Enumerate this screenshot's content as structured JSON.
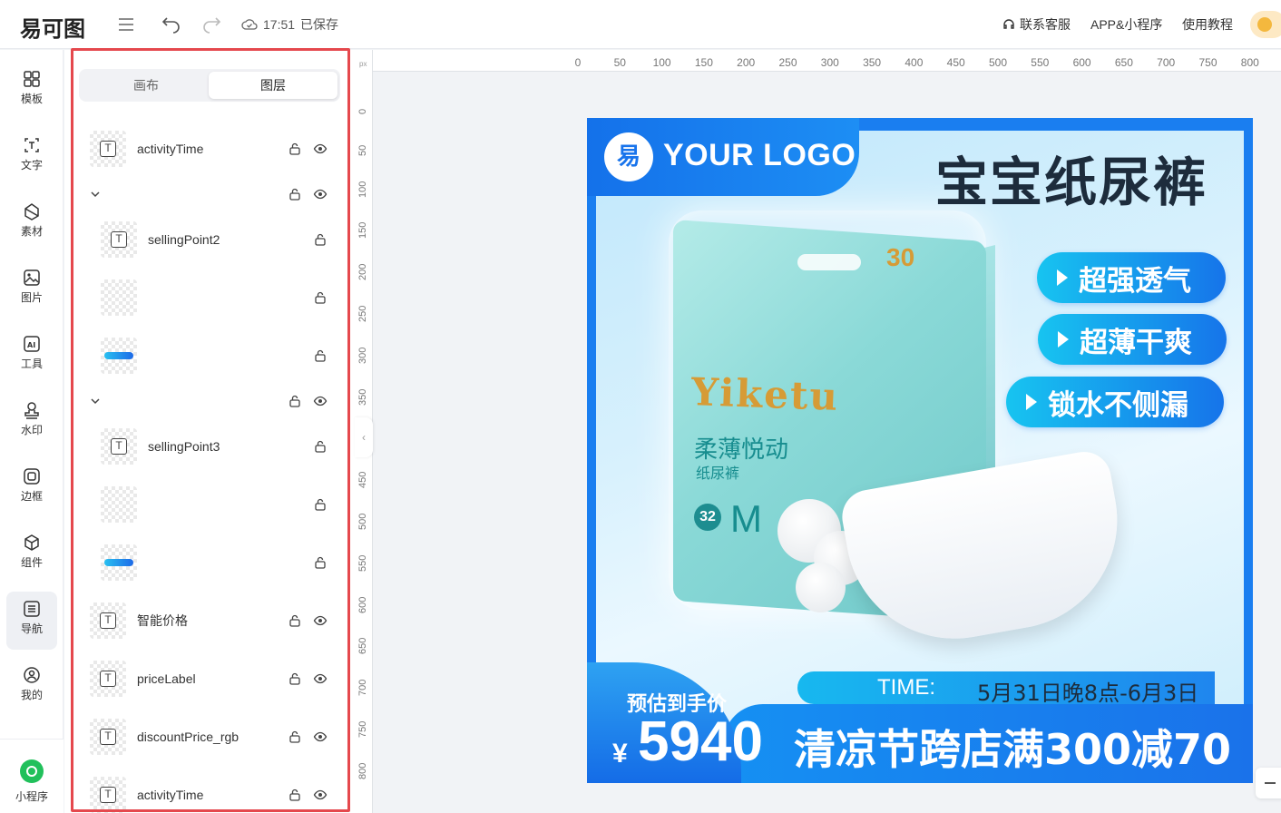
{
  "topbar": {
    "logo": "易可图",
    "save_time": "17:51",
    "save_status": "已保存",
    "contact": "联系客服",
    "app": "APP&小程序",
    "tutorial": "使用教程"
  },
  "rail": {
    "items": [
      {
        "label": "模板",
        "icon": "template-icon"
      },
      {
        "label": "文字",
        "icon": "text-icon"
      },
      {
        "label": "素材",
        "icon": "material-icon"
      },
      {
        "label": "图片",
        "icon": "image-icon"
      },
      {
        "label": "工具",
        "icon": "ai-tool-icon"
      },
      {
        "label": "水印",
        "icon": "watermark-icon"
      },
      {
        "label": "边框",
        "icon": "border-icon"
      },
      {
        "label": "组件",
        "icon": "component-icon"
      },
      {
        "label": "导航",
        "icon": "nav-icon"
      },
      {
        "label": "我的",
        "icon": "user-icon"
      }
    ],
    "mini_program": "小程序"
  },
  "panel": {
    "tab_canvas": "画布",
    "tab_layers": "图层",
    "layers": [
      {
        "name": "activityTime",
        "type": "text"
      },
      {
        "name": "",
        "type": "group"
      },
      {
        "name": "sellingPoint2",
        "type": "text"
      },
      {
        "name": "",
        "type": "image"
      },
      {
        "name": "",
        "type": "bar"
      },
      {
        "name": "",
        "type": "group"
      },
      {
        "name": "sellingPoint3",
        "type": "text"
      },
      {
        "name": "",
        "type": "image"
      },
      {
        "name": "",
        "type": "bar"
      },
      {
        "name": "智能价格",
        "type": "text"
      },
      {
        "name": "priceLabel",
        "type": "text"
      },
      {
        "name": "discountPrice_rgb",
        "type": "text"
      },
      {
        "name": "activityTime",
        "type": "text"
      }
    ]
  },
  "ruler": {
    "unit": "px",
    "top_ticks": [
      "0",
      "50",
      "100",
      "150",
      "200",
      "250",
      "300",
      "350",
      "400",
      "450",
      "500",
      "550",
      "600",
      "650",
      "700",
      "750",
      "800"
    ],
    "left_ticks": [
      "0",
      "50",
      "100",
      "150",
      "200",
      "250",
      "300",
      "350",
      "400",
      "450",
      "500",
      "550",
      "600",
      "650",
      "700",
      "750",
      "800"
    ]
  },
  "design": {
    "logo_mark": "易",
    "logo_text": "YOUR LOGO",
    "headline": "宝宝纸尿裤",
    "selling_points": [
      "超强透气",
      "超薄干爽",
      "锁水不侧漏"
    ],
    "product": {
      "brand": "Yiketu",
      "tagline": "柔薄悦动",
      "category": "纸尿裤",
      "count": "32",
      "size": "M",
      "badge": "30"
    },
    "time_label": "TIME:",
    "time_value": "5月31日晚8点-6月3日",
    "price_label": "预估到手价",
    "currency": "¥",
    "price": "5940",
    "promo": "清凉节跨店满300减70",
    "colors": {
      "primary": "#1a7ef0",
      "accent": "#17c4f0",
      "headline": "#1d2c3c",
      "brand_gold": "#d69b36"
    }
  }
}
